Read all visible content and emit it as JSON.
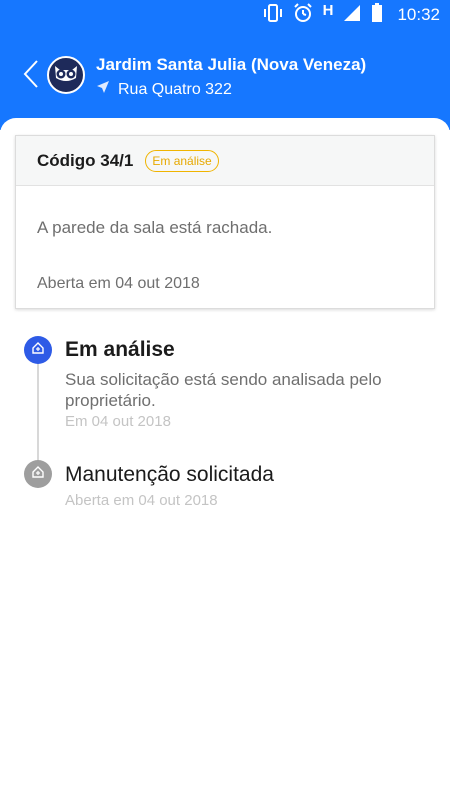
{
  "status_bar": {
    "network_letter": "H",
    "time": "10:32",
    "icons": [
      "vibrate-icon",
      "alarm-icon",
      "signal-icon",
      "battery-icon"
    ]
  },
  "header": {
    "title": "Jardim Santa Julia (Nova Veneza)",
    "address": "Rua Quatro 322",
    "icons": [
      "back-arrow-icon",
      "owl-avatar-icon",
      "location-arrow-icon"
    ]
  },
  "card": {
    "code": "Código 34/1",
    "status_badge": "Em análise",
    "description": "A parede da sala está rachada.",
    "opened": "Aberta em 04 out 2018"
  },
  "timeline": {
    "steps": [
      {
        "title": "Em análise",
        "description": "Sua solicitação está sendo analisada pelo proprietário.",
        "date": "Em 04 out 2018",
        "state": "active"
      },
      {
        "title": "Manutenção solicitada",
        "date": "Aberta em 04 out 2018",
        "state": "inactive"
      }
    ]
  },
  "colors": {
    "brand_blue": "#1677ff",
    "active_step": "#2e5be6",
    "inactive_step": "#9e9e9e",
    "badge_yellow": "#f0b400"
  }
}
